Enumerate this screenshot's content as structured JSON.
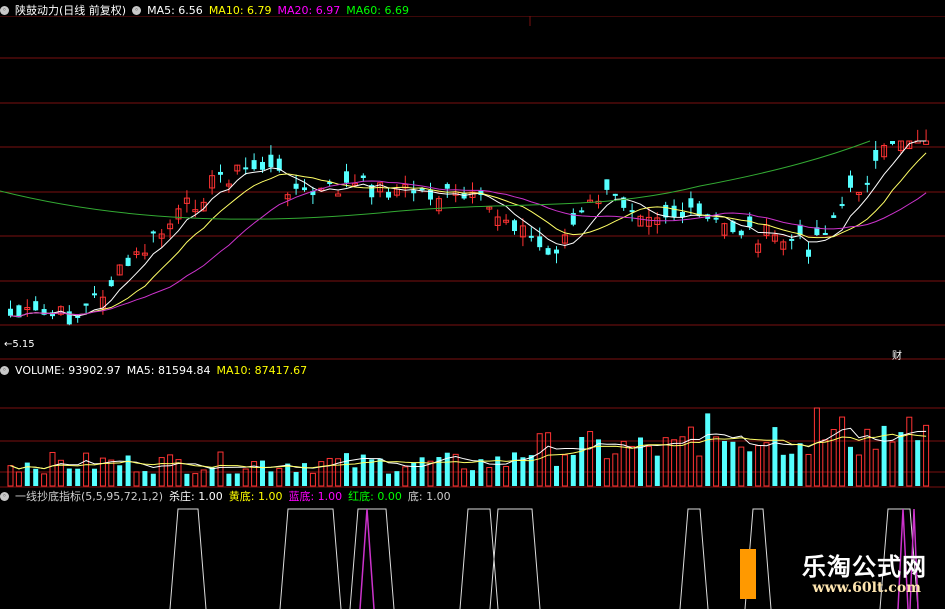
{
  "price_panel": {
    "title": "陕鼓动力(日线 前复权)",
    "indicators": [
      {
        "label": "MA5: 6.56",
        "color": "#ffffff"
      },
      {
        "label": "MA10: 6.79",
        "color": "#ffff00"
      },
      {
        "label": "MA20: 6.97",
        "color": "#ff00ff"
      },
      {
        "label": "MA60: 6.69",
        "color": "#00ff00"
      }
    ],
    "low_marker": "←5.15",
    "right_badge": "财"
  },
  "volume_panel": {
    "indicators": [
      {
        "label": "VOLUME: 93902.97",
        "color": "#ffffff"
      },
      {
        "label": "MA5: 81594.84",
        "color": "#ffffff"
      },
      {
        "label": "MA10: 87417.67",
        "color": "#ffff00"
      }
    ]
  },
  "signal_panel": {
    "indicators": [
      {
        "label": "一线抄底指标(5,5,95,72,1,2)",
        "color": "#cccccc"
      },
      {
        "label": "杀庄: 1.00",
        "color": "#ffffff"
      },
      {
        "label": "黄底: 1.00",
        "color": "#ffff00"
      },
      {
        "label": "蓝底: 1.00",
        "color": "#ff00ff"
      },
      {
        "label": "红底: 0.00",
        "color": "#00ff00"
      },
      {
        "label": "底: 1.00",
        "color": "#cccccc"
      }
    ]
  },
  "watermark": {
    "brand": "乐淘公式网",
    "url": "www.60lt.com"
  },
  "colors": {
    "up": "#ff3333",
    "down": "#55ffff",
    "grid": "#7a1010"
  }
}
